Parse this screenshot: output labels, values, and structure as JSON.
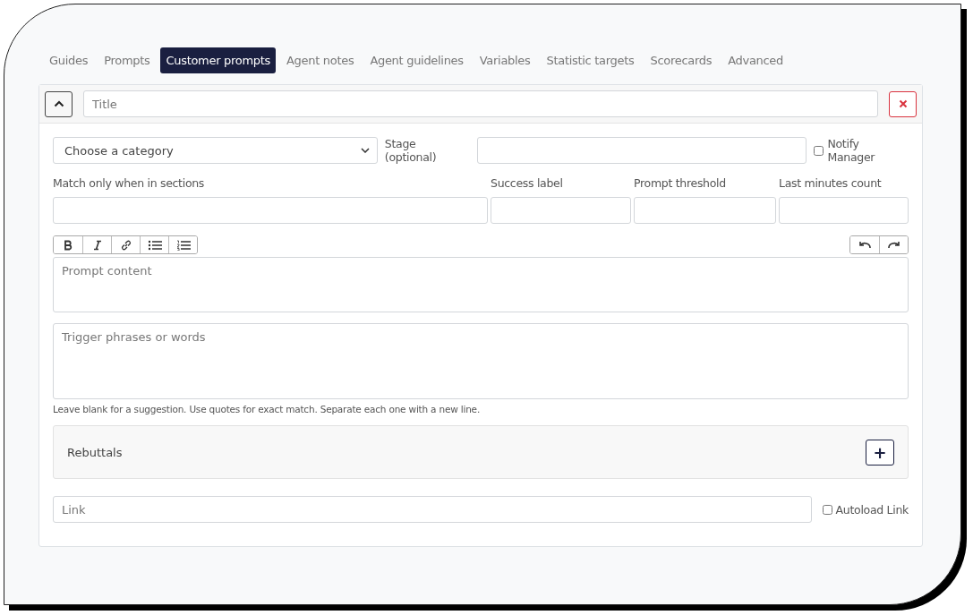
{
  "tabs": [
    {
      "label": "Guides",
      "selected": false
    },
    {
      "label": "Prompts",
      "selected": false
    },
    {
      "label": "Customer prompts",
      "selected": true
    },
    {
      "label": "Agent notes",
      "selected": false
    },
    {
      "label": "Agent guidelines",
      "selected": false
    },
    {
      "label": "Variables",
      "selected": false
    },
    {
      "label": "Statistic targets",
      "selected": false
    },
    {
      "label": "Scorecards",
      "selected": false
    },
    {
      "label": "Advanced",
      "selected": false
    }
  ],
  "title_field": {
    "placeholder": "Title"
  },
  "category_select": {
    "value": "Choose a category"
  },
  "stage": {
    "label": "Stage (optional)"
  },
  "notify_manager": {
    "label": "Notify Manager",
    "checked": false
  },
  "fields": [
    {
      "label": "Match only when in sections"
    },
    {
      "label": "Success label"
    },
    {
      "label": "Prompt threshold"
    },
    {
      "label": "Last minutes count"
    }
  ],
  "editor": {
    "placeholder": "Prompt content"
  },
  "triggers": {
    "placeholder": "Trigger phrases or words",
    "help": "Leave blank for a suggestion. Use quotes for exact match. Separate each one with a new line."
  },
  "rebuttals": {
    "label": "Rebuttals",
    "button": "+"
  },
  "link": {
    "placeholder": "Link"
  },
  "autoload_link": {
    "label": "Autoload Link",
    "checked": false
  }
}
